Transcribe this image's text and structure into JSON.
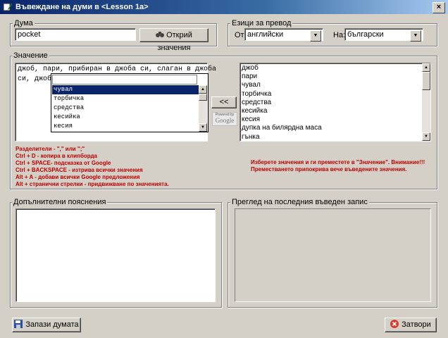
{
  "window": {
    "title": "Въвеждане на думи в <Lesson 1a>",
    "close_glyph": "×"
  },
  "word_group": {
    "label": "Дума",
    "word_value": "pocket",
    "find_button": "Открий значения"
  },
  "lang_group": {
    "label": "Езици за превод",
    "from_label": "От:",
    "from_value": "английски",
    "to_label": "На:",
    "to_value": "български"
  },
  "meaning_group": {
    "label": "Значение",
    "text_line1": "джоб, пари, прибиран в джоба си, слаган в джоба",
    "text_line2": "си, джобе",
    "autocomplete": [
      "чувал",
      "торбичка",
      "средства",
      "кесийка",
      "кесия"
    ],
    "autocomplete_selected_index": 0,
    "move_button": "<<",
    "google_powered": "Powered by",
    "google_logo": "Google",
    "results": [
      "джоб",
      "пари",
      "чувал",
      "торбичка",
      "средства",
      "кесийка",
      "кесия",
      "дупка на билярдна маса",
      "гънка"
    ]
  },
  "hints_left": [
    "Разделители - \",\" или \";\"",
    "Ctrl + D - копира в клипборда",
    "Ctrl + SPACE- подсказка от Google",
    "Ctrl + BACKSPACE - изтрива всички значения",
    "Alt + A - добави всички Google предложения",
    "Alt + странични стрелки - придвижване по значенията."
  ],
  "hints_right": [
    "Изберете значения и ги преместете в \"Значение\". Внимание!!!",
    "Преместването припокрива вече въведените значения."
  ],
  "extra_group": {
    "label": "Допълнителни пояснения"
  },
  "preview_group": {
    "label": "Преглед на последния въведен запис"
  },
  "footer": {
    "save_button": "Запази думата",
    "close_button": "Затвори"
  },
  "colors": {
    "titlebar": "#0a246a",
    "hint_red": "#c00000",
    "selection": "#0a246a"
  }
}
